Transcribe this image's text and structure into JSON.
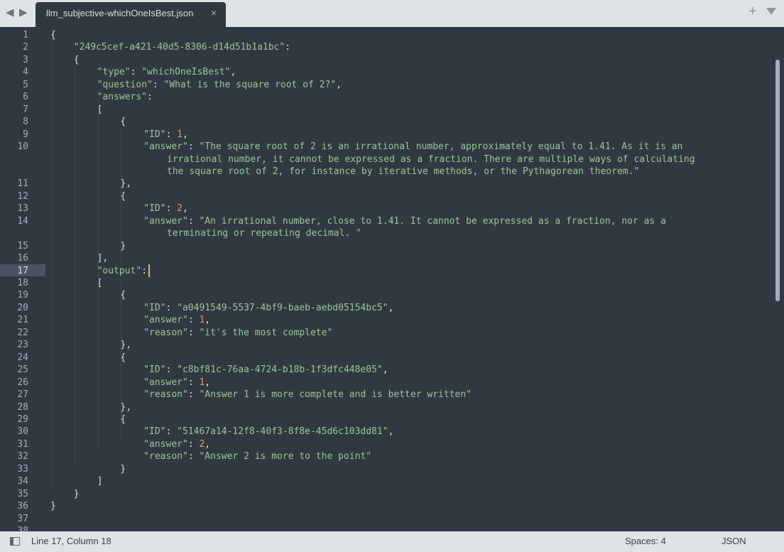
{
  "tab": {
    "title": "llm_subjective-whichOneIsBest.json",
    "close_glyph": "×"
  },
  "nav": {
    "back": "◀",
    "forward": "▶"
  },
  "plus_glyph": "+",
  "lines": [
    {
      "n": "1",
      "tokens": [
        {
          "t": "p",
          "v": "{"
        }
      ]
    },
    {
      "n": "2",
      "tokens": [
        {
          "t": "s",
          "v": "\"249c5cef-a421-40d5-8306-d14d51b1a1bc\""
        },
        {
          "t": "p",
          "v": ":"
        }
      ]
    },
    {
      "n": "3",
      "tokens": [
        {
          "t": "p",
          "v": "{"
        }
      ]
    },
    {
      "n": "4",
      "tokens": [
        {
          "t": "s",
          "v": "\"type\""
        },
        {
          "t": "p",
          "v": ": "
        },
        {
          "t": "s",
          "v": "\"whichOneIsBest\""
        },
        {
          "t": "p",
          "v": ","
        }
      ]
    },
    {
      "n": "5",
      "tokens": [
        {
          "t": "s",
          "v": "\"question\""
        },
        {
          "t": "p",
          "v": ": "
        },
        {
          "t": "s",
          "v": "\"What is the square root of 2?\""
        },
        {
          "t": "p",
          "v": ","
        }
      ]
    },
    {
      "n": "6",
      "tokens": [
        {
          "t": "s",
          "v": "\"answers\""
        },
        {
          "t": "p",
          "v": ":"
        }
      ]
    },
    {
      "n": "7",
      "tokens": [
        {
          "t": "p",
          "v": "["
        }
      ]
    },
    {
      "n": "8",
      "tokens": [
        {
          "t": "p",
          "v": "{"
        }
      ]
    },
    {
      "n": "9",
      "tokens": [
        {
          "t": "s",
          "v": "\"ID\""
        },
        {
          "t": "p",
          "v": ": "
        },
        {
          "t": "n",
          "v": "1"
        },
        {
          "t": "p",
          "v": ","
        }
      ]
    },
    {
      "n": "10",
      "tokens": [
        {
          "t": "s",
          "v": "\"answer\""
        },
        {
          "t": "p",
          "v": ": "
        },
        {
          "t": "s",
          "v": "\"The square root of 2 is an irrational number, approximately equal to 1.41. As it is an"
        }
      ]
    },
    {
      "n": "",
      "tokens": [
        {
          "t": "s",
          "v": "irrational number, it cannot be expressed as a fraction. There are multiple ways of calculating"
        }
      ]
    },
    {
      "n": "",
      "tokens": [
        {
          "t": "s",
          "v": "the square root of 2, for instance by iterative methods, or the Pythagorean theorem.\""
        }
      ]
    },
    {
      "n": "11",
      "tokens": [
        {
          "t": "p",
          "v": "},"
        }
      ]
    },
    {
      "n": "12",
      "tokens": [
        {
          "t": "p",
          "v": "{"
        }
      ]
    },
    {
      "n": "13",
      "tokens": [
        {
          "t": "s",
          "v": "\"ID\""
        },
        {
          "t": "p",
          "v": ": "
        },
        {
          "t": "n",
          "v": "2"
        },
        {
          "t": "p",
          "v": ","
        }
      ]
    },
    {
      "n": "14",
      "tokens": [
        {
          "t": "s",
          "v": "\"answer\""
        },
        {
          "t": "p",
          "v": ": "
        },
        {
          "t": "s",
          "v": "\"An irrational number, close to 1.41. It cannot be expressed as a fraction, nor as a"
        }
      ]
    },
    {
      "n": "",
      "tokens": [
        {
          "t": "s",
          "v": "terminating or repeating decimal. \""
        }
      ]
    },
    {
      "n": "15",
      "tokens": [
        {
          "t": "p",
          "v": "}"
        }
      ]
    },
    {
      "n": "16",
      "tokens": [
        {
          "t": "p",
          "v": "],"
        }
      ]
    },
    {
      "n": "17",
      "tokens": [
        {
          "t": "s",
          "v": "\"output\""
        },
        {
          "t": "p",
          "v": ":"
        }
      ]
    },
    {
      "n": "18",
      "tokens": [
        {
          "t": "p",
          "v": "["
        }
      ]
    },
    {
      "n": "19",
      "tokens": [
        {
          "t": "p",
          "v": "{"
        }
      ]
    },
    {
      "n": "20",
      "tokens": [
        {
          "t": "s",
          "v": "\"ID\""
        },
        {
          "t": "p",
          "v": ": "
        },
        {
          "t": "s",
          "v": "\"a0491549-5537-4bf9-baeb-aebd05154bc5\""
        },
        {
          "t": "p",
          "v": ","
        }
      ]
    },
    {
      "n": "21",
      "tokens": [
        {
          "t": "s",
          "v": "\"answer\""
        },
        {
          "t": "p",
          "v": ": "
        },
        {
          "t": "n",
          "v": "1"
        },
        {
          "t": "p",
          "v": ","
        }
      ]
    },
    {
      "n": "22",
      "tokens": [
        {
          "t": "s",
          "v": "\"reason\""
        },
        {
          "t": "p",
          "v": ": "
        },
        {
          "t": "s",
          "v": "\"it's the most complete\""
        }
      ]
    },
    {
      "n": "23",
      "tokens": [
        {
          "t": "p",
          "v": "},"
        }
      ]
    },
    {
      "n": "24",
      "tokens": [
        {
          "t": "p",
          "v": "{"
        }
      ]
    },
    {
      "n": "25",
      "tokens": [
        {
          "t": "s",
          "v": "\"ID\""
        },
        {
          "t": "p",
          "v": ": "
        },
        {
          "t": "s",
          "v": "\"c8bf81c-76aa-4724-b18b-1f3dfc448e05\""
        },
        {
          "t": "p",
          "v": ","
        }
      ]
    },
    {
      "n": "26",
      "tokens": [
        {
          "t": "s",
          "v": "\"answer\""
        },
        {
          "t": "p",
          "v": ": "
        },
        {
          "t": "n",
          "v": "1"
        },
        {
          "t": "p",
          "v": ","
        }
      ]
    },
    {
      "n": "27",
      "tokens": [
        {
          "t": "s",
          "v": "\"reason\""
        },
        {
          "t": "p",
          "v": ": "
        },
        {
          "t": "s",
          "v": "\"Answer 1 is more complete and is better written\""
        }
      ]
    },
    {
      "n": "28",
      "tokens": [
        {
          "t": "p",
          "v": "},"
        }
      ]
    },
    {
      "n": "29",
      "tokens": [
        {
          "t": "p",
          "v": "{"
        }
      ]
    },
    {
      "n": "30",
      "tokens": [
        {
          "t": "s",
          "v": "\"ID\""
        },
        {
          "t": "p",
          "v": ": "
        },
        {
          "t": "s",
          "v": "\"51467a14-12f8-40f3-8f8e-45d6c103dd81\""
        },
        {
          "t": "p",
          "v": ","
        }
      ]
    },
    {
      "n": "31",
      "tokens": [
        {
          "t": "s",
          "v": "\"answer\""
        },
        {
          "t": "p",
          "v": ": "
        },
        {
          "t": "n",
          "v": "2"
        },
        {
          "t": "p",
          "v": ","
        }
      ]
    },
    {
      "n": "32",
      "tokens": [
        {
          "t": "s",
          "v": "\"reason\""
        },
        {
          "t": "p",
          "v": ": "
        },
        {
          "t": "s",
          "v": "\"Answer 2 is more to the point\""
        }
      ]
    },
    {
      "n": "33",
      "tokens": [
        {
          "t": "p",
          "v": "}"
        }
      ]
    },
    {
      "n": "34",
      "tokens": [
        {
          "t": "p",
          "v": "]"
        }
      ]
    },
    {
      "n": "35",
      "tokens": [
        {
          "t": "p",
          "v": "}"
        }
      ]
    },
    {
      "n": "36",
      "tokens": [
        {
          "t": "p",
          "v": "}"
        }
      ]
    },
    {
      "n": "37",
      "tokens": []
    },
    {
      "n": "38",
      "tokens": []
    }
  ],
  "active_line": "17",
  "status": {
    "position": "Line 17, Column 18",
    "indent": "Spaces: 4",
    "syntax": "JSON"
  },
  "colors": {
    "background": "#303841",
    "string": "#99c794",
    "number": "#f99157",
    "cursor": "#f9ae58",
    "chrome": "#dfe3e6"
  }
}
